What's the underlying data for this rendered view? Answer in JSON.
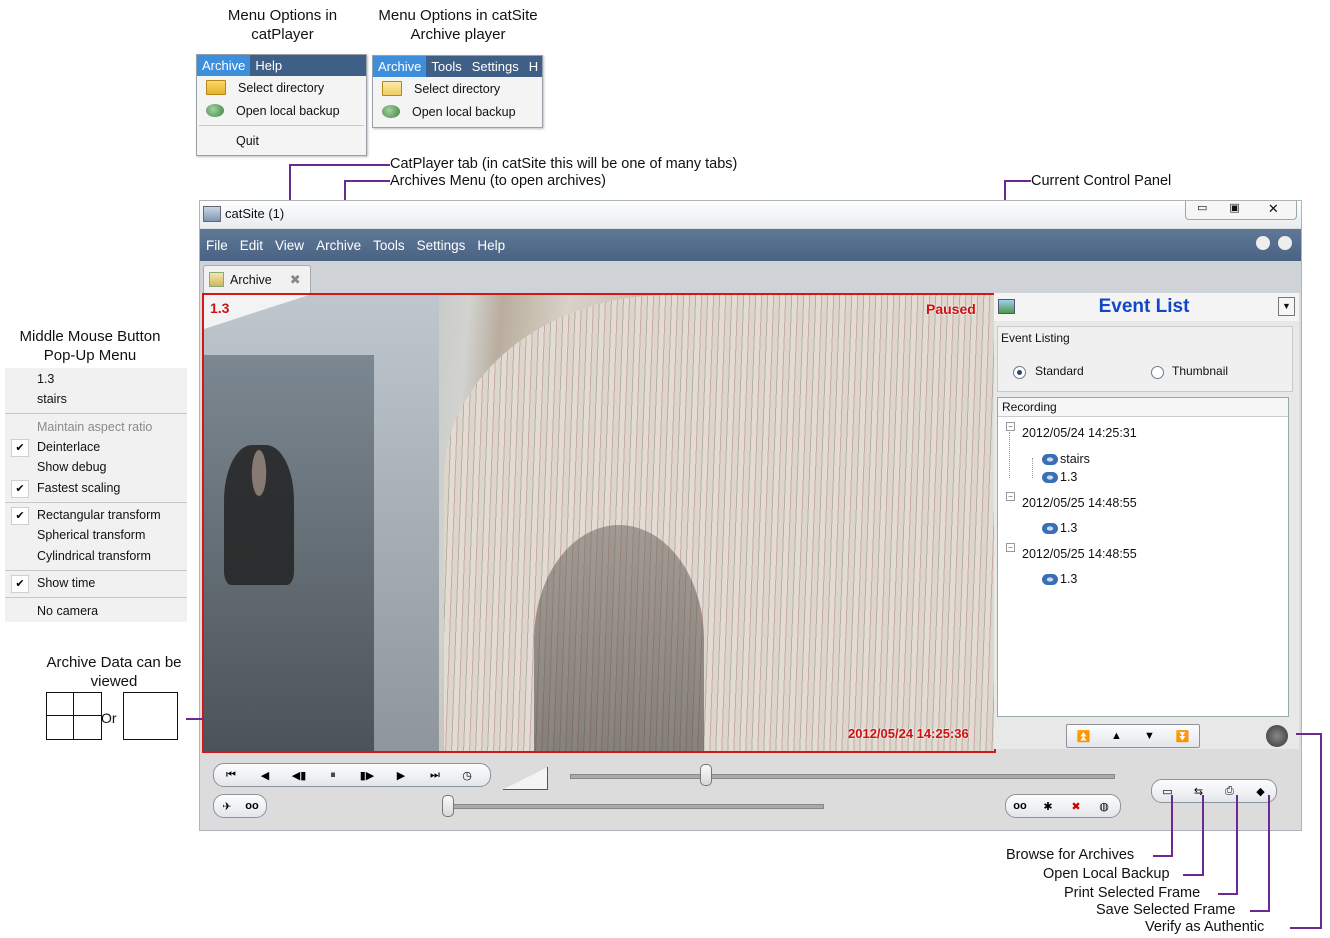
{
  "captions": {
    "menu_catplayer": "Menu Options in catPlayer",
    "menu_catsite": "Menu Options in catSite Archive player",
    "middle_mouse": "Middle Mouse Button Pop-Up Menu",
    "archive_view": "Archive Data can be viewed",
    "or_label": "Or"
  },
  "catplayer_menu": {
    "bar": [
      "Archive",
      "Help"
    ],
    "items": [
      "Select directory",
      "Open local backup",
      "Quit"
    ]
  },
  "catsite_menu": {
    "bar": [
      "Archive",
      "Tools",
      "Settings",
      "H"
    ],
    "items": [
      "Select directory",
      "Open local backup"
    ]
  },
  "annotations": {
    "catplayer_tab": "CatPlayer tab (in catSite this will be one of many tabs)",
    "archives_menu": "Archives Menu (to open archives)",
    "control_panel": "Current Control Panel",
    "browse": "Browse for Archives",
    "open_backup": "Open Local Backup",
    "print_frame": "Print Selected Frame",
    "save_frame": "Save Selected Frame",
    "verify": "Verify as Authentic"
  },
  "window": {
    "title": "catSite (1)",
    "menu": [
      "File",
      "Edit",
      "View",
      "Archive",
      "Tools",
      "Settings",
      "Help"
    ],
    "tab_label": "Archive"
  },
  "video": {
    "camera": "1.3",
    "status": "Paused",
    "timestamp": "2012/05/24 14:25:36"
  },
  "event_panel": {
    "title": "Event List",
    "listing_label": "Event Listing",
    "standard": "Standard",
    "thumbnail": "Thumbnail",
    "recording_label": "Recording",
    "groups": [
      {
        "date": "2012/05/24 14:25:31",
        "cams": [
          "stairs",
          "1.3"
        ]
      },
      {
        "date": "2012/05/25 14:48:55",
        "cams": [
          "1.3"
        ]
      },
      {
        "date": "2012/05/25 14:48:55",
        "cams": [
          "1.3"
        ]
      }
    ]
  },
  "popup_menu": {
    "cam": "1.3",
    "stairs": "stairs",
    "aspect": "Maintain aspect ratio",
    "deinterlace": "Deinterlace",
    "show_debug": "Show debug",
    "fastest": "Fastest scaling",
    "rect": "Rectangular transform",
    "spherical": "Spherical transform",
    "cylindrical": "Cylindrical transform",
    "show_time": "Show time",
    "no_camera": "No camera"
  },
  "colors": {
    "accent": "#1247c8",
    "menubar": "#3f5f86",
    "video_border": "#d01818",
    "annotation_line": "#6b2a8f"
  }
}
